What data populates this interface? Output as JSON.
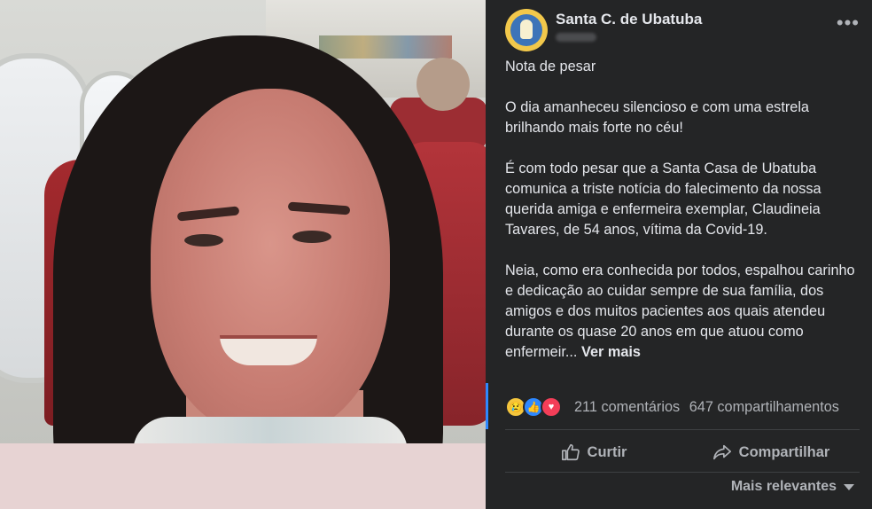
{
  "post": {
    "page_name": "Santa C. de Ubatuba",
    "paragraphs": [
      "Nota de pesar",
      "O dia amanheceu silencioso e com uma estrela brilhando mais forte no céu!",
      "É com todo pesar que a Santa Casa de Ubatuba comunica a triste notícia do falecimento da nossa querida amiga e enfermeira exemplar, Claudineia Tavares, de 54 anos, vítima da Covid-19."
    ],
    "last_paragraph": "Neia, como era conhecida por todos, espalhou carinho e dedicação ao cuidar sempre de sua família, dos amigos e dos muitos pacientes aos quais atendeu durante os quase 20 anos em que atuou como enfermeir...",
    "see_more": "Ver mais",
    "comments": "211 comentários",
    "shares": "647 compartilhamentos",
    "actions": {
      "like": "Curtir",
      "share": "Compartilhar"
    },
    "sort": "Mais relevantes",
    "reaction_icons": [
      "sad-reaction-icon",
      "like-reaction-icon",
      "love-reaction-icon"
    ]
  },
  "colors": {
    "background": "#242526",
    "text": "#e4e6eb",
    "secondary": "#b0b3b8",
    "like_blue": "#2d88ff"
  }
}
